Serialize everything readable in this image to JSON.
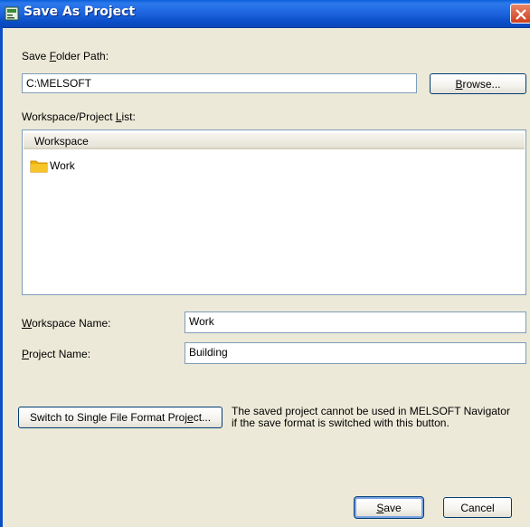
{
  "window": {
    "title": "Save As Project"
  },
  "save_folder": {
    "label_pre": "Save ",
    "label_key": "F",
    "label_post": "older Path:",
    "value": "C:\\MELSOFT",
    "browse_pre": "",
    "browse_key": "B",
    "browse_post": "rowse..."
  },
  "list": {
    "label_pre": "Workspace/Project ",
    "label_key": "L",
    "label_post": "ist:",
    "column_header": "Workspace",
    "items": [
      {
        "label": "Work",
        "icon": "folder-icon"
      }
    ]
  },
  "workspace_name": {
    "label_pre": "",
    "label_key": "W",
    "label_post": "orkspace Name:",
    "value": "Work"
  },
  "project_name": {
    "label_pre": "",
    "label_key": "P",
    "label_post": "roject Name:",
    "value": "Building"
  },
  "switch": {
    "button_pre": "Switch to Single File Format Proj",
    "button_key": "e",
    "button_post": "ct...",
    "note_line1": "The saved project cannot be used in MELSOFT Navigator",
    "note_line2": "if the save format is switched with this button."
  },
  "buttons": {
    "save_pre": "",
    "save_key": "S",
    "save_post": "ave",
    "cancel": "Cancel"
  },
  "colors": {
    "titlebar": "#0a5fd8",
    "dialog_bg": "#ece9d8",
    "folder": "#f0b400",
    "close": "#cf3d1c"
  }
}
